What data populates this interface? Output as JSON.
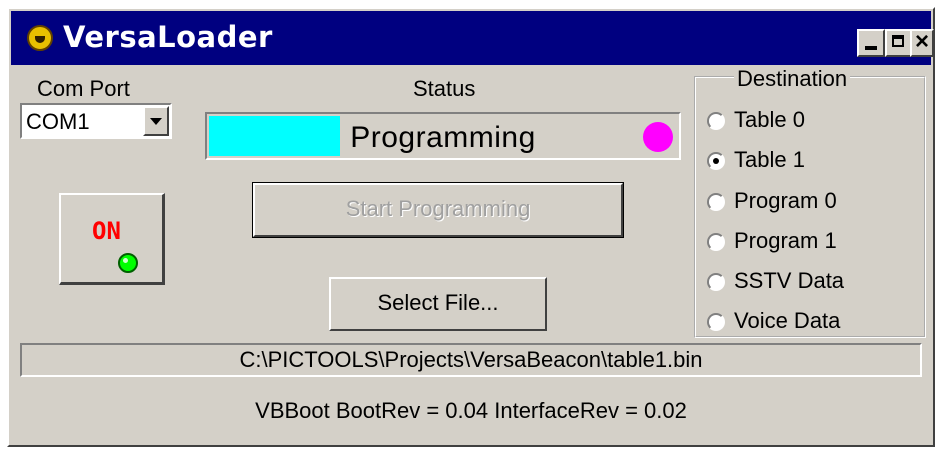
{
  "window": {
    "title": "VersaLoader",
    "close_glyph": "×",
    "icons": {
      "app": "app-logo-icon",
      "minimize": "minimize-icon",
      "maximize": "maximize-icon",
      "close": "close-icon"
    }
  },
  "com_port": {
    "label": "Com Port",
    "selected": "COM1"
  },
  "status": {
    "label": "Status",
    "text": "Programming",
    "progress_percent": 28,
    "indicator_color": "#ff00ff",
    "progress_color": "#00ffff"
  },
  "power_button": {
    "label": "ON",
    "led_color": "#00ff00"
  },
  "buttons": {
    "start_programming": "Start Programming",
    "select_file": "Select File..."
  },
  "destination": {
    "label": "Destination",
    "options": [
      {
        "label": "Table 0",
        "checked": false
      },
      {
        "label": "Table 1",
        "checked": true
      },
      {
        "label": "Program 0",
        "checked": false
      },
      {
        "label": "Program 1",
        "checked": false
      },
      {
        "label": "SSTV Data",
        "checked": false
      },
      {
        "label": "Voice Data",
        "checked": false
      }
    ]
  },
  "file_path": "C:\\PICTOOLS\\Projects\\VersaBeacon\\table1.bin",
  "version_info": "VBBoot  BootRev = 0.04   InterfaceRev = 0.02"
}
